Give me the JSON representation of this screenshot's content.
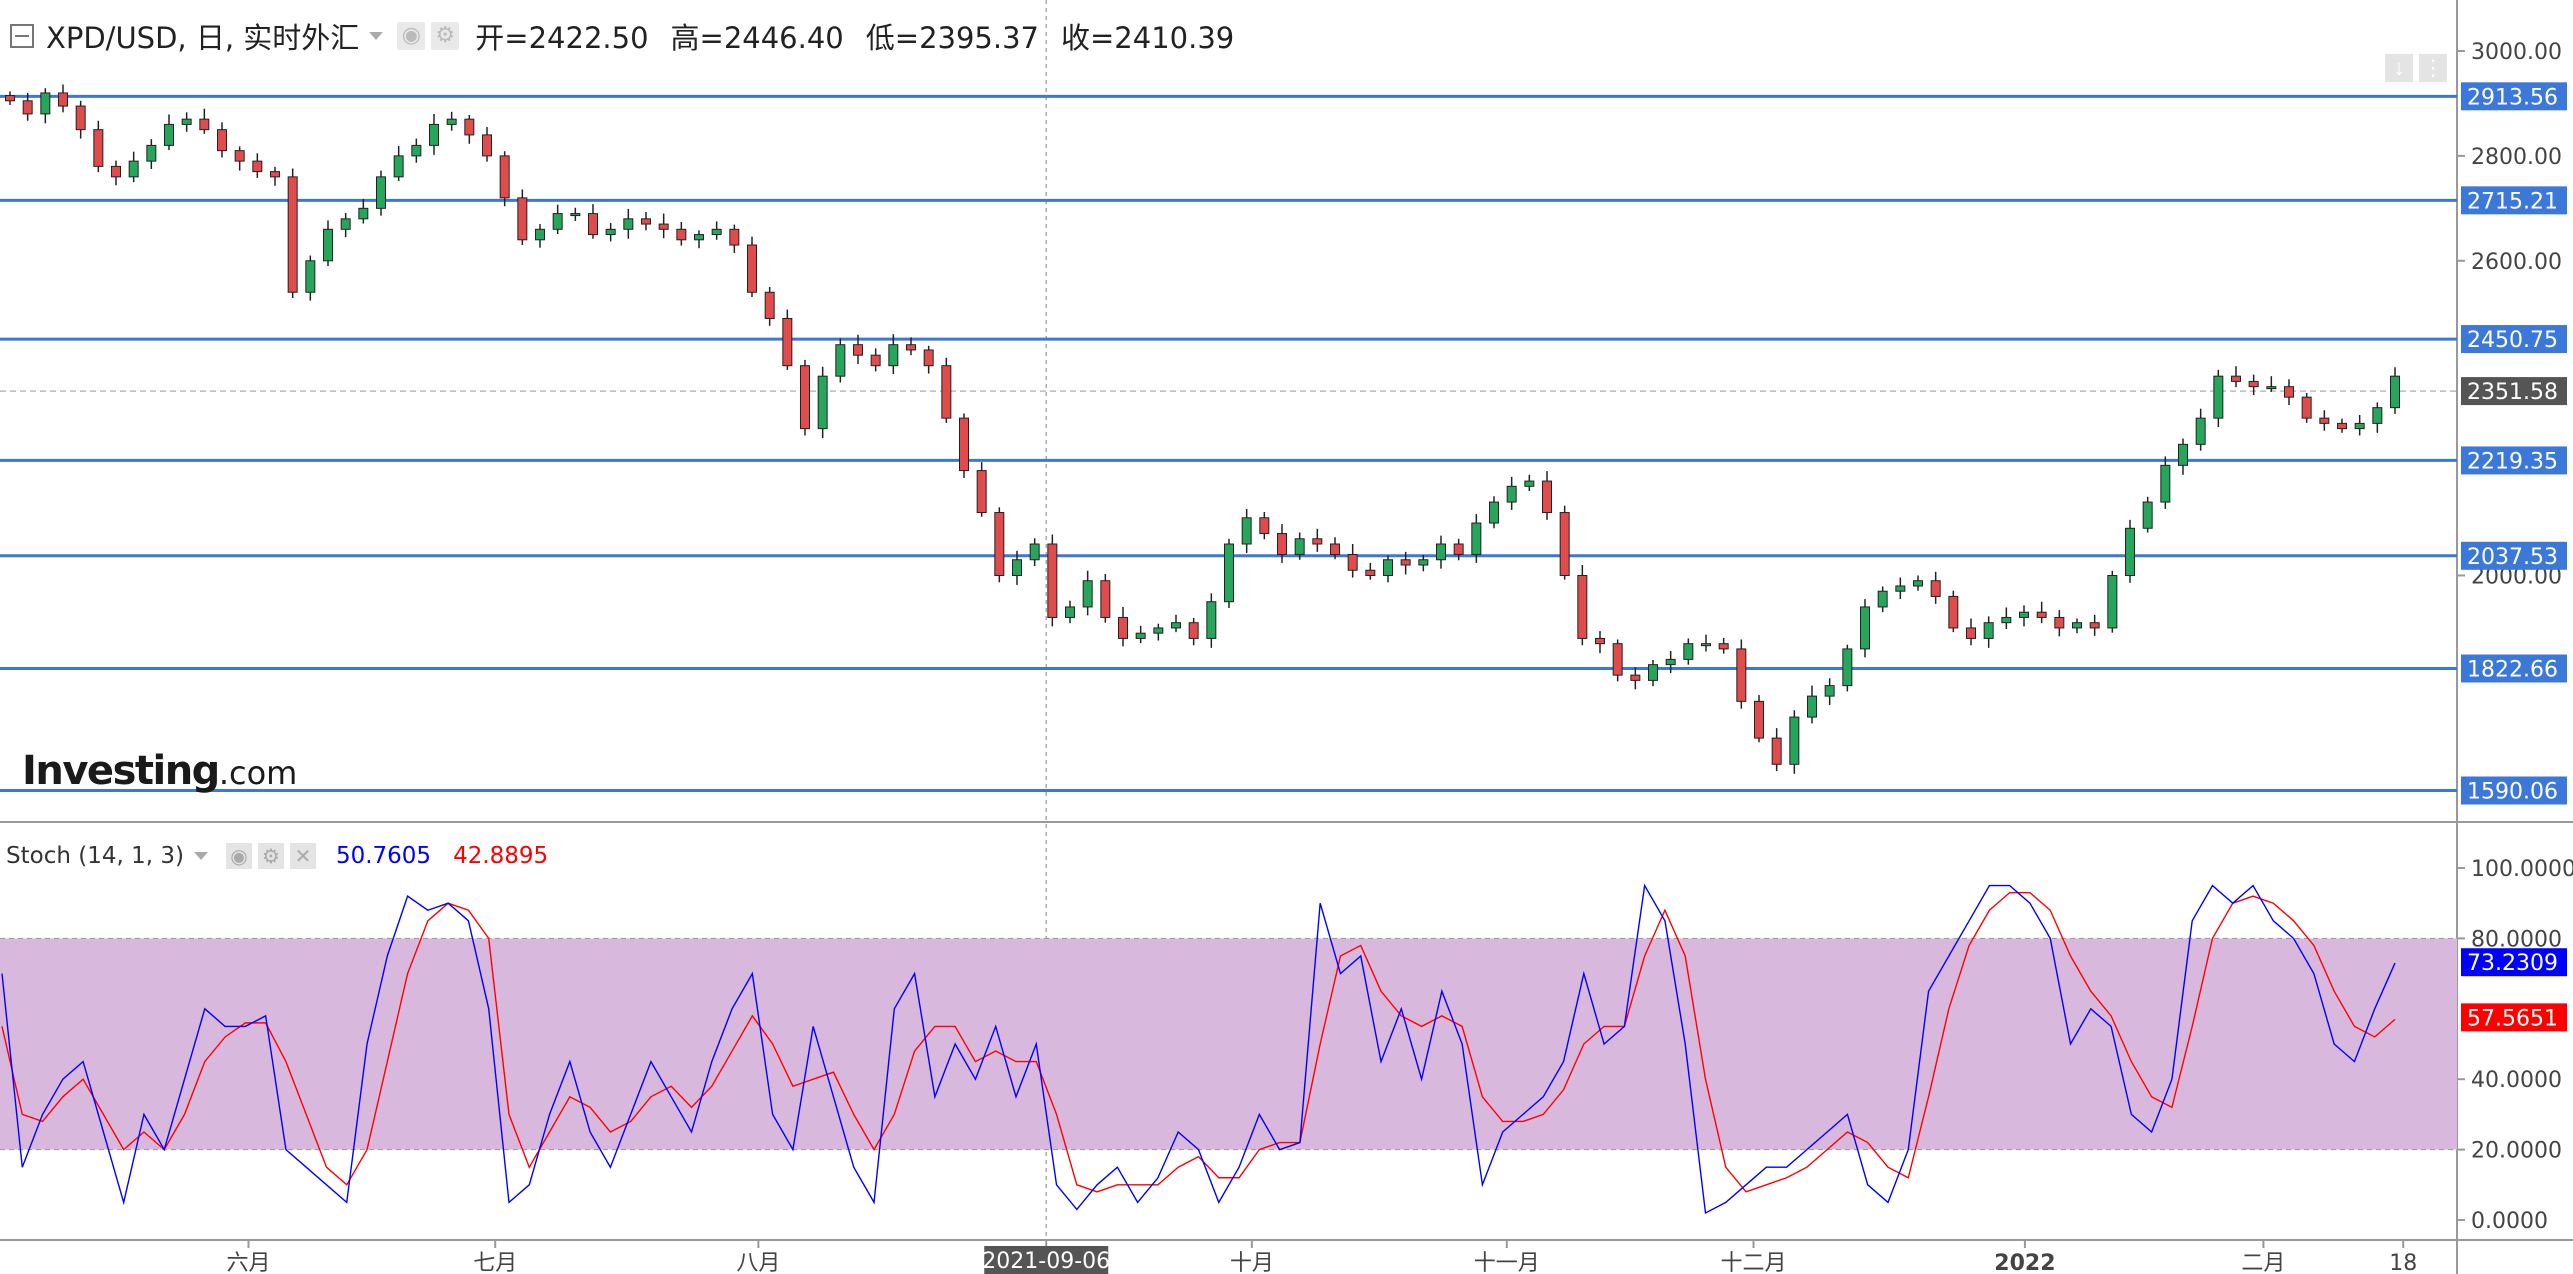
{
  "header": {
    "symbol": "XPD/USD, 日, 实时外汇",
    "open": "开=2422.50",
    "high": "高=2446.40",
    "low": "低=2395.37",
    "close": "收=2410.39"
  },
  "logo": {
    "main": "Investing",
    "suffix": ".com"
  },
  "stoch": {
    "label": "Stoch (14, 1, 3)",
    "k_value": "50.7605",
    "d_value": "42.8895",
    "k_color": "#0000ff",
    "d_color": "#ff0000",
    "k_badge": "73.2309",
    "d_badge": "57.5651",
    "y_ticks": [
      "100.0000",
      "80.0000",
      "40.0000",
      "20.0000",
      "0.0000"
    ]
  },
  "crosshair": {
    "date": "2021-09-06"
  },
  "price_badge": "2351.58",
  "x_labels": [
    "六月",
    "七月",
    "八月",
    "2021-09-06",
    "十月",
    "十一月",
    "十二月",
    "2022",
    "二月",
    "18"
  ],
  "chart_data": {
    "type": "candlestick",
    "y_ticks": [
      3000,
      2800,
      2600,
      2000
    ],
    "ylim": [
      1530,
      3040
    ],
    "horizontal_levels": [
      2913.56,
      2715.21,
      2450.75,
      2219.35,
      2037.53,
      1822.66,
      1590.06
    ],
    "last_price": 2351.58,
    "colors": {
      "up": "#26a65b",
      "down": "#e04b4b",
      "level": "#3c78d8",
      "stoch_band": "#d9b8de"
    },
    "x_label_dates": [
      "2021-06-01",
      "2021-07-01",
      "2021-08-02",
      "2021-09-06",
      "2021-10-01",
      "2021-11-01",
      "2021-12-01",
      "2022-01-03",
      "2022-02-01",
      "2022-02-18"
    ],
    "x_range": [
      "2021-05-03",
      "2022-02-17"
    ],
    "price_series_close": [
      2905,
      2880,
      2920,
      2895,
      2850,
      2780,
      2760,
      2790,
      2820,
      2860,
      2870,
      2850,
      2810,
      2790,
      2770,
      2760,
      2540,
      2600,
      2660,
      2680,
      2700,
      2760,
      2800,
      2820,
      2860,
      2870,
      2840,
      2800,
      2720,
      2640,
      2660,
      2690,
      2690,
      2650,
      2660,
      2680,
      2670,
      2660,
      2640,
      2650,
      2660,
      2630,
      2540,
      2490,
      2400,
      2280,
      2380,
      2440,
      2420,
      2400,
      2440,
      2430,
      2400,
      2300,
      2200,
      2120,
      2000,
      2030,
      2060,
      1920,
      1940,
      1990,
      1920,
      1880,
      1890,
      1900,
      1910,
      1880,
      1950,
      2060,
      2110,
      2080,
      2040,
      2070,
      2060,
      2040,
      2010,
      2000,
      2030,
      2020,
      2030,
      2060,
      2040,
      2100,
      2140,
      2170,
      2180,
      2120,
      2000,
      1880,
      1870,
      1810,
      1800,
      1830,
      1840,
      1870,
      1870,
      1860,
      1760,
      1690,
      1640,
      1730,
      1770,
      1790,
      1860,
      1940,
      1970,
      1980,
      1990,
      1960,
      1900,
      1880,
      1910,
      1920,
      1930,
      1920,
      1900,
      1910,
      1900,
      2000,
      2090,
      2140,
      2210,
      2250,
      2300,
      2380,
      2370,
      2360,
      2360,
      2340,
      2300,
      2290,
      2280,
      2290,
      2320,
      2380
    ],
    "stoch_k": [
      70,
      15,
      30,
      40,
      45,
      25,
      5,
      30,
      20,
      40,
      60,
      55,
      55,
      58,
      20,
      15,
      10,
      5,
      50,
      75,
      92,
      88,
      90,
      85,
      60,
      5,
      10,
      30,
      45,
      25,
      15,
      30,
      45,
      35,
      25,
      45,
      60,
      70,
      30,
      20,
      55,
      35,
      15,
      5,
      60,
      70,
      35,
      50,
      40,
      55,
      35,
      50,
      10,
      3,
      10,
      15,
      5,
      12,
      25,
      20,
      5,
      15,
      30,
      20,
      22,
      90,
      70,
      75,
      45,
      60,
      40,
      65,
      50,
      10,
      25,
      30,
      35,
      45,
      70,
      50,
      55,
      95,
      85,
      50,
      2,
      5,
      10,
      15,
      15,
      20,
      25,
      30,
      10,
      5,
      20,
      65,
      75,
      85,
      95,
      95,
      90,
      80,
      50,
      60,
      55,
      30,
      25,
      40,
      85,
      95,
      90,
      95,
      85,
      80,
      70,
      50,
      45,
      60,
      73
    ],
    "stoch_d": [
      55,
      30,
      28,
      35,
      40,
      30,
      20,
      25,
      20,
      30,
      45,
      52,
      56,
      56,
      45,
      30,
      15,
      10,
      20,
      45,
      70,
      85,
      90,
      88,
      80,
      30,
      15,
      25,
      35,
      32,
      25,
      28,
      35,
      38,
      32,
      38,
      48,
      58,
      50,
      38,
      40,
      42,
      30,
      20,
      30,
      48,
      55,
      55,
      45,
      48,
      45,
      45,
      30,
      10,
      8,
      10,
      10,
      10,
      15,
      18,
      12,
      12,
      20,
      22,
      22,
      50,
      75,
      78,
      65,
      58,
      55,
      58,
      55,
      35,
      28,
      28,
      30,
      37,
      50,
      55,
      55,
      75,
      88,
      75,
      40,
      15,
      8,
      10,
      12,
      15,
      20,
      25,
      22,
      15,
      12,
      35,
      60,
      78,
      88,
      93,
      93,
      88,
      75,
      65,
      58,
      45,
      35,
      32,
      55,
      80,
      90,
      92,
      90,
      85,
      78,
      65,
      55,
      52,
      57
    ]
  }
}
